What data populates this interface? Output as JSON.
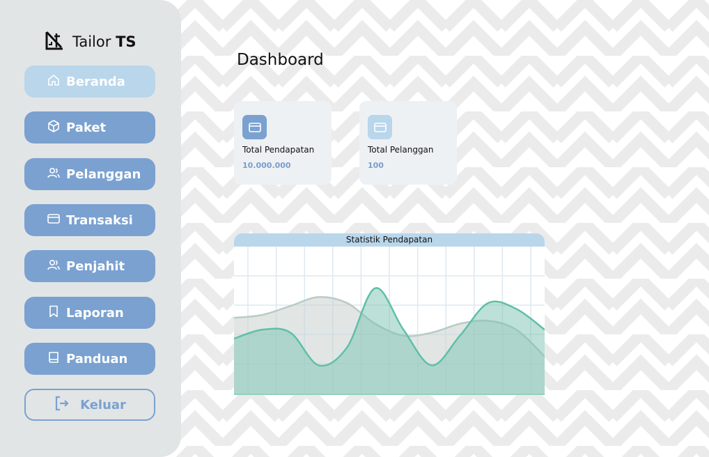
{
  "sidebar": {
    "brand_prefix": "Tailor",
    "brand_suffix": "TS",
    "items": [
      {
        "label": "Beranda",
        "icon": "home-icon",
        "active": true
      },
      {
        "label": "Paket",
        "icon": "box-icon",
        "active": false
      },
      {
        "label": "Pelanggan",
        "icon": "users-icon",
        "active": false
      },
      {
        "label": "Transaksi",
        "icon": "credit-card-icon",
        "active": false
      },
      {
        "label": "Penjahit",
        "icon": "users-icon",
        "active": false
      },
      {
        "label": "Laporan",
        "icon": "bookmark-icon",
        "active": false
      },
      {
        "label": "Panduan",
        "icon": "book-icon",
        "active": false
      }
    ],
    "logout_label": "Keluar"
  },
  "main": {
    "title": "Dashboard",
    "cards": [
      {
        "label": "Total Pendapatan",
        "value": "10.000.000",
        "icon": "credit-card-icon"
      },
      {
        "label": "Total Pelanggan",
        "value": "100",
        "icon": "credit-card-icon"
      }
    ],
    "chart_title": "Statistik Pendapatan"
  },
  "colors": {
    "primary": "#7aa1d0",
    "active": "#b9d6eb",
    "sidebar_bg": "#e2e5e6",
    "series_teal": "#5fbfa8",
    "series_gray": "#b9cbc4"
  },
  "chart_data": {
    "type": "area",
    "title": "Statistik Pendapatan",
    "x": [
      0,
      1,
      2,
      3,
      4,
      5,
      6,
      7,
      8,
      9,
      10,
      11
    ],
    "series": [
      {
        "values": [
          2.6,
          2.7,
          3.0,
          3.3,
          3.1,
          2.4,
          2.0,
          2.1,
          2.4,
          2.5,
          2.2,
          1.3
        ]
      },
      {
        "values": [
          1.9,
          2.2,
          2.1,
          1.0,
          1.6,
          3.6,
          2.2,
          1.0,
          2.0,
          3.1,
          2.9,
          2.2
        ]
      }
    ],
    "ylim": [
      0,
      5
    ],
    "grid": true,
    "legend": "none"
  }
}
